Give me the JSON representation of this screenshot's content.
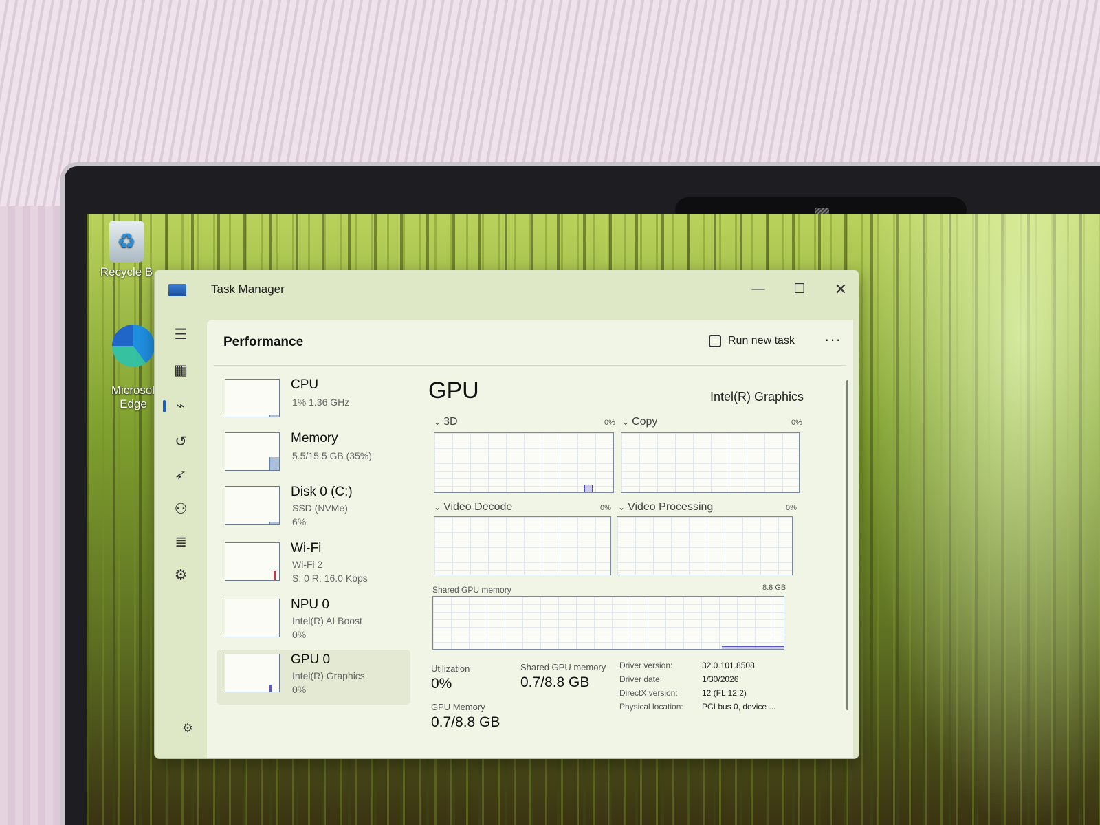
{
  "desktop": {
    "icons": [
      {
        "label": "Recycle B",
        "icon": "recycle-bin-icon"
      },
      {
        "label": "Microsof\nEdge",
        "icon": "edge-icon"
      }
    ]
  },
  "window": {
    "title": "Task Manager",
    "controls": {
      "minimize": "—",
      "maximize": "☐",
      "close": "✕"
    }
  },
  "nav": {
    "items": [
      {
        "name": "menu-icon",
        "glyph": "☰"
      },
      {
        "name": "processes-icon",
        "glyph": "▦"
      },
      {
        "name": "performance-icon",
        "glyph": "⌁",
        "active": true
      },
      {
        "name": "app-history-icon",
        "glyph": "↺"
      },
      {
        "name": "startup-apps-icon",
        "glyph": "➶"
      },
      {
        "name": "users-icon",
        "glyph": "⚇"
      },
      {
        "name": "details-icon",
        "glyph": "≣"
      },
      {
        "name": "services-icon",
        "glyph": "⚙"
      }
    ],
    "settings_glyph": "⚙"
  },
  "header": {
    "title": "Performance",
    "run_new_task": "Run new task",
    "more": "···"
  },
  "devices": [
    {
      "name": "CPU",
      "line1": "1%  1.36 GHz",
      "line2": "",
      "usage": 0.01
    },
    {
      "name": "Memory",
      "line1": "5.5/15.5 GB (35%)",
      "line2": "",
      "usage": 0.35
    },
    {
      "name": "Disk 0 (C:)",
      "line1": "SSD (NVMe)",
      "line2": "6%",
      "usage": 0.06
    },
    {
      "name": "Wi-Fi",
      "line1": "Wi-Fi 2",
      "line2": "S: 0  R: 16.0 Kbps",
      "usage": 0.3
    },
    {
      "name": "NPU 0",
      "line1": "Intel(R) AI Boost",
      "line2": "0%",
      "usage": 0
    },
    {
      "name": "GPU 0",
      "line1": "Intel(R) Graphics",
      "line2": "0%",
      "usage": 0.08,
      "selected": true
    }
  ],
  "gpu": {
    "title": "GPU",
    "adapter": "Intel(R) Graphics",
    "engines": [
      {
        "label": "3D",
        "pct": "0%"
      },
      {
        "label": "Copy",
        "pct": "0%"
      },
      {
        "label": "Video Decode",
        "pct": "0%"
      },
      {
        "label": "Video Processing",
        "pct": "0%"
      }
    ],
    "shared_memory_graph": {
      "label": "Shared GPU memory",
      "max": "8.8 GB"
    },
    "stats": {
      "utilization_label": "Utilization",
      "utilization_value": "0%",
      "shared_label": "Shared GPU memory",
      "shared_value": "0.7/8.8 GB",
      "gpu_memory_label": "GPU Memory",
      "gpu_memory_value": "0.7/8.8 GB"
    },
    "properties": [
      {
        "label": "Driver version:",
        "value": "32.0.101.8508"
      },
      {
        "label": "Driver date:",
        "value": "1/30/2026"
      },
      {
        "label": "DirectX version:",
        "value": "12 (FL 12.2)"
      },
      {
        "label": "Physical location:",
        "value": "PCI bus 0, device ..."
      }
    ]
  }
}
